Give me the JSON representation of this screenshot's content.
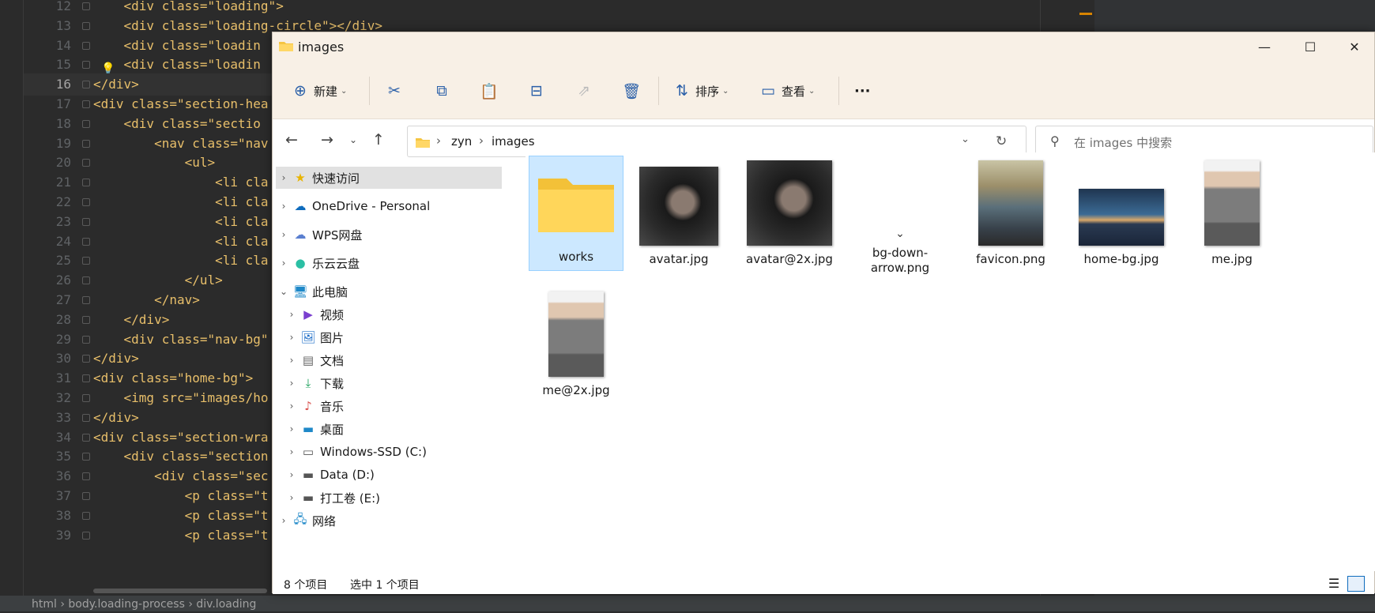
{
  "ide": {
    "lines": [
      {
        "n": "12",
        "html": "    <div class=\"loading\">"
      },
      {
        "n": "13",
        "html": "    <div class=\"loading-circle\"></div>"
      },
      {
        "n": "14",
        "html": "    <div class=\"loadin"
      },
      {
        "n": "15",
        "html": "    <div class=\"loadin"
      },
      {
        "n": "16",
        "html": "</div>"
      },
      {
        "n": "17",
        "html": "<div class=\"section-hea"
      },
      {
        "n": "18",
        "html": "    <div class=\"sectio"
      },
      {
        "n": "19",
        "html": "        <nav class=\"nav"
      },
      {
        "n": "20",
        "html": "            <ul>"
      },
      {
        "n": "21",
        "html": "                <li cla"
      },
      {
        "n": "22",
        "html": "                <li cla"
      },
      {
        "n": "23",
        "html": "                <li cla"
      },
      {
        "n": "24",
        "html": "                <li cla"
      },
      {
        "n": "25",
        "html": "                <li cla"
      },
      {
        "n": "26",
        "html": "            </ul>"
      },
      {
        "n": "27",
        "html": "        </nav>"
      },
      {
        "n": "28",
        "html": "    </div>"
      },
      {
        "n": "29",
        "html": "    <div class=\"nav-bg\""
      },
      {
        "n": "30",
        "html": "</div>"
      },
      {
        "n": "31",
        "html": "<div class=\"home-bg\">"
      },
      {
        "n": "32",
        "html": "    <img src=\"images/ho"
      },
      {
        "n": "33",
        "html": "</div>"
      },
      {
        "n": "34",
        "html": "<div class=\"section-wra"
      },
      {
        "n": "35",
        "html": "    <div class=\"section"
      },
      {
        "n": "36",
        "html": "        <div class=\"sec"
      },
      {
        "n": "37",
        "html": "            <p class=\"t"
      },
      {
        "n": "38",
        "html": "            <p class=\"t"
      },
      {
        "n": "39",
        "html": "            <p class=\"t"
      }
    ],
    "status": "html  ›  body.loading-process  ›  div.loading"
  },
  "explorer": {
    "title": "images",
    "toolbar": {
      "new_label": "新建",
      "sort_label": "排序",
      "view_label": "查看",
      "more_label": "···"
    },
    "address": {
      "crumb1": "zyn",
      "crumb2": "images"
    },
    "search_placeholder": "在 images 中搜索",
    "nav": {
      "quick": "快速访问",
      "onedrive": "OneDrive - Personal",
      "wps": "WPS网盘",
      "leyun": "乐云云盘",
      "pc": "此电脑",
      "video": "视频",
      "pictures": "图片",
      "docs": "文档",
      "downloads": "下载",
      "music": "音乐",
      "desktop": "桌面",
      "c": "Windows-SSD (C:)",
      "d": "Data (D:)",
      "e": "打工卷 (E:)",
      "network": "网络"
    },
    "files": {
      "f1": "works",
      "f2": "avatar.jpg",
      "f3": "avatar@2x.jpg",
      "f4": "bg-down-arrow.png",
      "f5": "favicon.png",
      "f6": "home-bg.jpg",
      "f7": "me.jpg",
      "f8": "me@2x.jpg"
    },
    "status": {
      "count": "8 个项目",
      "selected": "选中 1 个项目"
    }
  }
}
